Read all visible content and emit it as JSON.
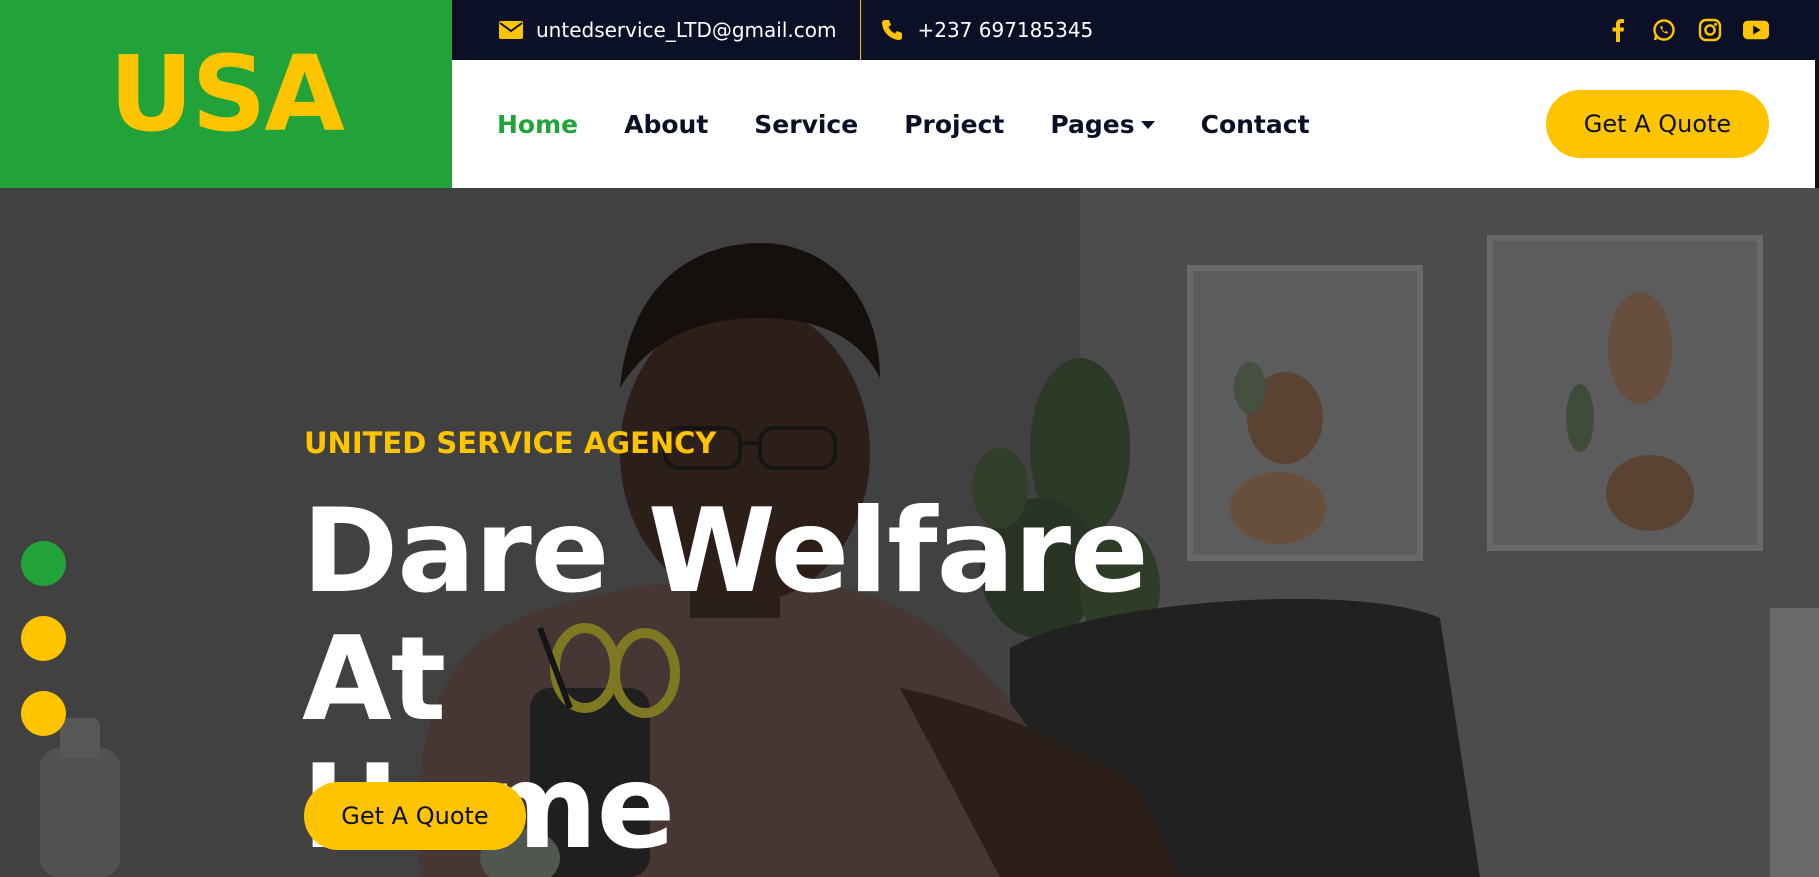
{
  "brand": {
    "logo_text": "USA",
    "green": "#22a33a",
    "yellow": "#ffc400",
    "navy": "#0b1026"
  },
  "topbar": {
    "email": "untedservice_LTD@gmail.com",
    "phone": "+237 697185345",
    "email_icon": "envelope-icon",
    "phone_icon": "phone-icon",
    "socials": [
      "facebook-icon",
      "whatsapp-icon",
      "instagram-icon",
      "youtube-icon"
    ]
  },
  "nav": {
    "items": [
      {
        "label": "Home",
        "active": true
      },
      {
        "label": "About",
        "active": false
      },
      {
        "label": "Service",
        "active": false
      },
      {
        "label": "Project",
        "active": false
      },
      {
        "label": "Pages",
        "active": false,
        "dropdown": true
      },
      {
        "label": "Contact",
        "active": false
      }
    ],
    "cta_label": "Get A Quote"
  },
  "hero": {
    "eyebrow": "UNITED SERVICE AGENCY",
    "title_line1": "Dare Welfare At",
    "title_line2": "Home",
    "cta_label": "Get A Quote",
    "carousel_dots": 3,
    "active_dot": 1
  }
}
